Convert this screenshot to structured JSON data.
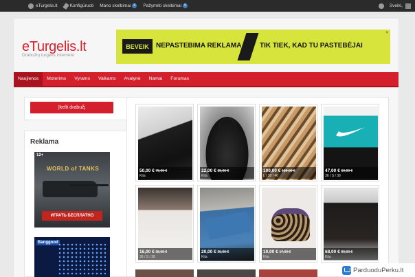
{
  "adminbar": {
    "site_name": "eTurgelis.lt",
    "customize": "Konfigūruoti",
    "menu_item_a": "Mano skelbimai",
    "menu_item_a_count": "0",
    "menu_item_b": "Pažymėti skelbimai",
    "menu_item_b_count": "0",
    "user_greeting": "Sveiki,"
  },
  "header": {
    "logo": "eTurgelis.lt",
    "tagline": "Drabužių turgelis internete"
  },
  "banner": {
    "badge": "BEVEIK",
    "text1": "NEPASTEBIMA REKLAMA",
    "text2": "TIK TIEK, KAD TU PASTEBĖJAI",
    "close": "✕"
  },
  "nav": {
    "items": [
      "Naujienos",
      "Moterims",
      "Vyrams",
      "Vaikams",
      "Avalynė",
      "Namai",
      "Forumas"
    ]
  },
  "sidebar": {
    "post_button": "Įkelti drabužį",
    "ads_title": "Reklama",
    "ad1": {
      "age": "12+",
      "logo": "WORLD of TANKS",
      "cta": "ИГРАТЬ БЕСПЛАТНО"
    },
    "ad2": {
      "logo": "Banggood"
    }
  },
  "products": [
    {
      "price": "50,00 €",
      "price_old": "75,00 €",
      "size": "Kita"
    },
    {
      "price": "22,00 €",
      "price_old": "35,00 €",
      "size": "Kita"
    },
    {
      "price": "100,00 €",
      "price_old": "150,00 €",
      "size": "L / 38 / 40"
    },
    {
      "price": "47,00 €",
      "price_old": "60,00 €",
      "size": "36 / S / 38"
    },
    {
      "price": "16,00 €",
      "price_old": "25,00 €",
      "size": "36 / S / 38"
    },
    {
      "price": "20,00 €",
      "price_old": "25,00 €",
      "size": "Kita"
    },
    {
      "price": "10,00 €",
      "price_old": "17,00 €",
      "size": "Kita"
    },
    {
      "price": "68,00 €",
      "price_old": "80,00 €",
      "size": "Kita"
    }
  ],
  "watermark": {
    "text": "ParduoduPerku.lt"
  }
}
